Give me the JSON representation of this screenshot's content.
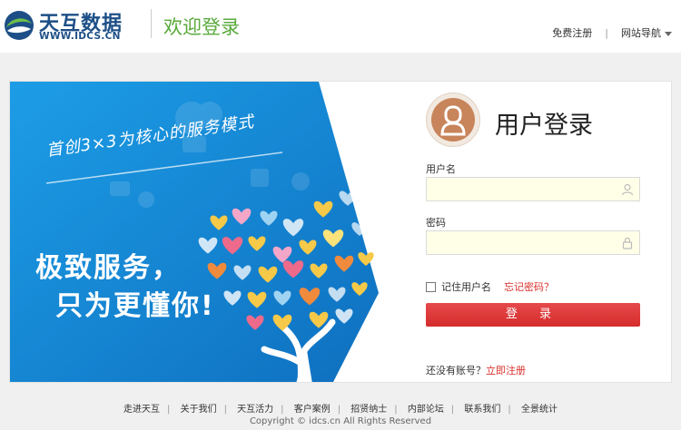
{
  "header": {
    "logo_cn": "天互数据",
    "logo_en": "WWW.IDCS.CN",
    "welcome": "欢迎登录",
    "register_link": "免费注册",
    "sitenav_link": "网站导航"
  },
  "banner": {
    "slogan_small": "首创3×3为核心的服务模式",
    "slogan_line1": "极致服务，",
    "slogan_line2": "只为更懂你!"
  },
  "login": {
    "title": "用户登录",
    "username_label": "用户名",
    "username_value": "",
    "password_label": "密码",
    "password_value": "",
    "remember_label": "记住用户名",
    "forgot_link": "忘记密码？",
    "login_button": "登 录",
    "no_account_text": "还没有账号？",
    "register_now": "立即注册"
  },
  "footer": {
    "links": [
      "走进天互",
      "关于我们",
      "天互活力",
      "客户案例",
      "招贤纳士",
      "内部论坛",
      "联系我们",
      "全景统计"
    ],
    "copyright": "Copyright © idcs.cn All Rights Reserved"
  },
  "colors": {
    "brand_blue": "#1d4f86",
    "brand_green": "#5aaa3c",
    "accent_red": "#d9302b",
    "banner_blue": "#1a8fd8"
  }
}
